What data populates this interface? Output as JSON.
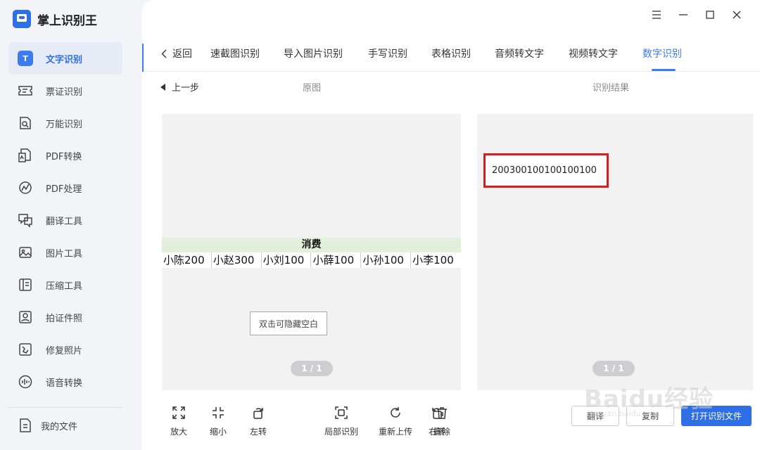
{
  "app": {
    "name": "掌上识别王"
  },
  "sidebar": {
    "items": [
      {
        "label": "文字识别",
        "icon": "text-recognition-icon",
        "active_glyph": "T"
      },
      {
        "label": "票证识别",
        "icon": "ticket-icon"
      },
      {
        "label": "万能识别",
        "icon": "universal-scan-icon"
      },
      {
        "label": "PDF转换",
        "icon": "pdf-convert-icon"
      },
      {
        "label": "PDF处理",
        "icon": "pdf-process-icon"
      },
      {
        "label": "翻译工具",
        "icon": "translate-icon"
      },
      {
        "label": "图片工具",
        "icon": "image-tool-icon"
      },
      {
        "label": "压缩工具",
        "icon": "compress-icon"
      },
      {
        "label": "拍证件照",
        "icon": "id-photo-icon"
      },
      {
        "label": "修复照片",
        "icon": "photo-repair-icon"
      },
      {
        "label": "语音转换",
        "icon": "voice-convert-icon"
      }
    ],
    "my_files": "我的文件"
  },
  "tabs": {
    "back": "返回",
    "items": [
      "速截图识别",
      "导入图片识别",
      "手写识别",
      "表格识别",
      "音频转文字",
      "视频转文字",
      "数字识别"
    ],
    "active": "数字识别"
  },
  "subbar": {
    "prev_step": "上一步",
    "original_title": "原图",
    "result_title": "识别结果"
  },
  "original": {
    "sheet_title": "消费",
    "cells": [
      "小陈200",
      "小赵300",
      "小刘100",
      "小薛100",
      "小孙100",
      "小李100"
    ],
    "hide_blank_button": "双击可隐藏空白",
    "page_indicator": "1 / 1"
  },
  "result": {
    "text": "200300100100100100",
    "page_indicator": "1 / 1"
  },
  "toolbar": [
    "放大",
    "缩小",
    "左转",
    "右转",
    "局部识别",
    "重新上传",
    "删除"
  ],
  "actions": {
    "translate": "翻译",
    "copy": "复制",
    "open_file": "打开识别文件"
  },
  "watermark": {
    "text": "Baidu经验",
    "sub": "jingyan.baidu.com"
  },
  "colors": {
    "accent": "#3d7bf0",
    "highlight_border": "#d91c1c",
    "sheet_header_bg": "#e2efda"
  }
}
